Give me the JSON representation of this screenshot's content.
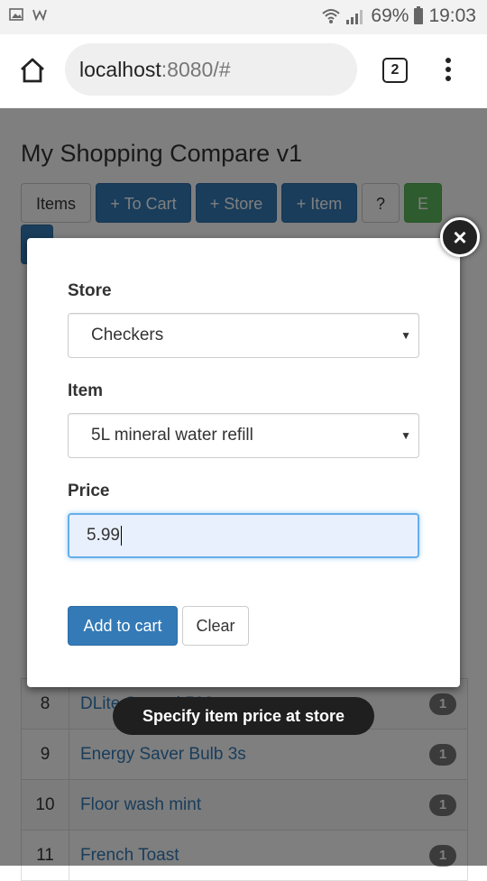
{
  "status_bar": {
    "battery_percent": "69%",
    "time": "19:03"
  },
  "browser": {
    "url_host": "localhost",
    "url_rest": ":8080/#",
    "tab_count": "2"
  },
  "page": {
    "title": "My Shopping Compare v1",
    "nav_buttons": [
      "Items",
      "+ To Cart",
      "+ Store",
      "+ Item",
      "?",
      "E"
    ],
    "rows": [
      {
        "num": "8",
        "name": "DLite Spread 500g",
        "badge": "1"
      },
      {
        "num": "9",
        "name": "Energy Saver Bulb 3s",
        "badge": "1"
      },
      {
        "num": "10",
        "name": "Floor wash mint",
        "badge": "1"
      },
      {
        "num": "11",
        "name": "French Toast",
        "badge": "1"
      }
    ]
  },
  "modal": {
    "close_label": "×",
    "store_label": "Store",
    "store_value": "Checkers",
    "item_label": "Item",
    "item_value": "5L mineral water refill",
    "price_label": "Price",
    "price_value": "5.99",
    "add_to_cart_label": "Add to cart",
    "clear_label": "Clear"
  },
  "toast": {
    "message": "Specify item price at store"
  },
  "colors": {
    "primary": "#337ab7",
    "success": "#5cb85c",
    "badge": "#777777",
    "focus_border": "#66afe9"
  },
  "icons": [
    "image-icon",
    "app-icon",
    "wifi-icon",
    "signal-icon",
    "battery-icon",
    "home-icon",
    "tabs-icon",
    "menu-icon",
    "close-icon",
    "dropdown-arrow-icon"
  ]
}
